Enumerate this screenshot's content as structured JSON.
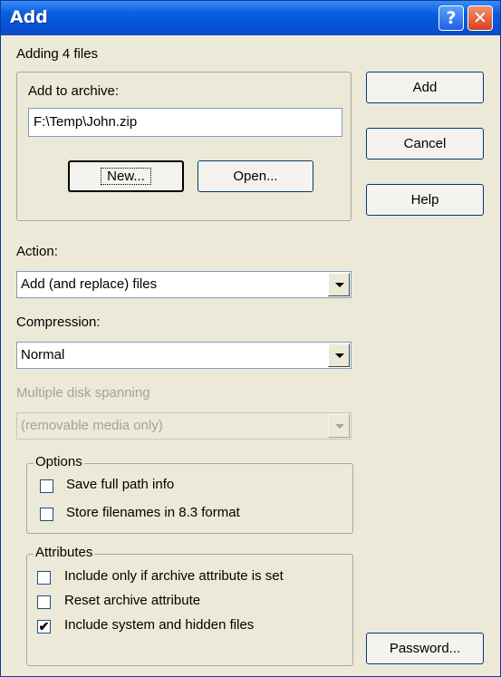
{
  "window": {
    "title": "Add",
    "help_glyph": "?",
    "close_glyph": "✕"
  },
  "status": "Adding 4 files",
  "archive": {
    "group_label": "Add to archive:",
    "path_value": "F:\\Temp\\John.zip",
    "new_label": "New...",
    "open_label": "Open..."
  },
  "side_buttons": {
    "add": "Add",
    "cancel": "Cancel",
    "help": "Help",
    "password": "Password..."
  },
  "action": {
    "label": "Action:",
    "value": "Add (and replace) files"
  },
  "compression": {
    "label": "Compression:",
    "value": "Normal"
  },
  "spanning": {
    "label": "Multiple disk spanning",
    "value": "(removable media only)"
  },
  "options": {
    "label": "Options",
    "items": [
      {
        "label": "Save full path info",
        "checked": false
      },
      {
        "label": "Store filenames in 8.3 format",
        "checked": false
      }
    ]
  },
  "attributes": {
    "label": "Attributes",
    "items": [
      {
        "label": "Include only if archive attribute is set",
        "checked": false
      },
      {
        "label": "Reset archive attribute",
        "checked": false
      },
      {
        "label": "Include system and hidden files",
        "checked": true
      }
    ]
  },
  "icons": {
    "dropdown": "chevron-down-icon",
    "check": "checkmark-icon",
    "help": "question-icon",
    "close": "close-icon"
  },
  "colors": {
    "titlebar": "#0454d8",
    "dialog_bg": "#ece9d8",
    "close_button": "#d7421c"
  }
}
